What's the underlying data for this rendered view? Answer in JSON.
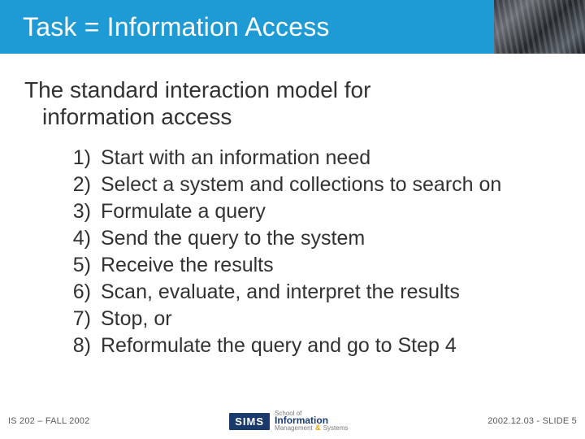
{
  "title": "Task = Information Access",
  "lead_l1": "The standard interaction model for",
  "lead_l2": "information access",
  "steps": [
    "Start with an information need",
    "Select a system and collections to search on",
    "Formulate a query",
    "Send the query to the system",
    "Receive the results",
    "Scan, evaluate, and interpret the results",
    "Stop, or",
    "Reformulate the query and go to Step 4"
  ],
  "step_nums": [
    "1)",
    "2)",
    "3)",
    "4)",
    "5)",
    "6)",
    "7)",
    "8)"
  ],
  "footer": {
    "left": "IS 202 – FALL 2002",
    "right": "2002.12.03 - SLIDE 5",
    "logo": {
      "sims": "SIMS",
      "top": "School of",
      "mid": "Information",
      "bot_pre": "Management ",
      "bot_amp": "&",
      "bot_post": " Systems"
    }
  }
}
